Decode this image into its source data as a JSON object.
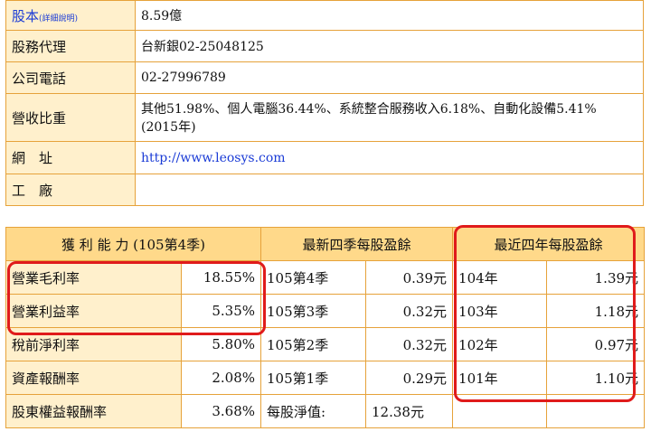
{
  "info_rows": [
    {
      "label": "股本",
      "label_note": "(詳細說明)",
      "value": "8.59億"
    },
    {
      "label": "股務代理",
      "value": "台新銀02-25048125"
    },
    {
      "label": "公司電話",
      "value": "02-27996789"
    },
    {
      "label": "營收比重",
      "value": "其他51.98%、個人電腦36.44%、系統整合服務收入6.18%、自動化設備5.41% (2015年)"
    },
    {
      "label": "網　址",
      "value": "http://www.leosys.com"
    },
    {
      "label": "工　廠",
      "value": ""
    }
  ],
  "headers": {
    "profit": "獲 利 能 力 (105第4季)",
    "eps_recent": "最新四季每股盈餘",
    "eps_years": "最近四年每股盈餘"
  },
  "profit_rows": [
    {
      "label": "營業毛利率",
      "value": "18.55%"
    },
    {
      "label": "營業利益率",
      "value": "5.35%"
    },
    {
      "label": "稅前淨利率",
      "value": "5.80%"
    },
    {
      "label": "資產報酬率",
      "value": "2.08%"
    },
    {
      "label": "股東權益報酬率",
      "value": "3.68%"
    }
  ],
  "eps_quarters": [
    {
      "label": "105第4季",
      "value": "0.39元"
    },
    {
      "label": "105第3季",
      "value": "0.32元"
    },
    {
      "label": "105第2季",
      "value": "0.32元"
    },
    {
      "label": "105第1季",
      "value": "0.29元"
    }
  ],
  "eps_years": [
    {
      "label": "104年",
      "value": "1.39元"
    },
    {
      "label": "103年",
      "value": "1.18元"
    },
    {
      "label": "102年",
      "value": "0.97元"
    },
    {
      "label": "101年",
      "value": "1.10元"
    }
  ],
  "nav": {
    "label": "每股淨值:",
    "value": "12.38元"
  },
  "colors": {
    "border": "#e6a23a",
    "label_bg": "#fff0cc",
    "header_bg": "#ffd98a",
    "highlight": "#e01b1b",
    "link": "#1a3bd6"
  }
}
